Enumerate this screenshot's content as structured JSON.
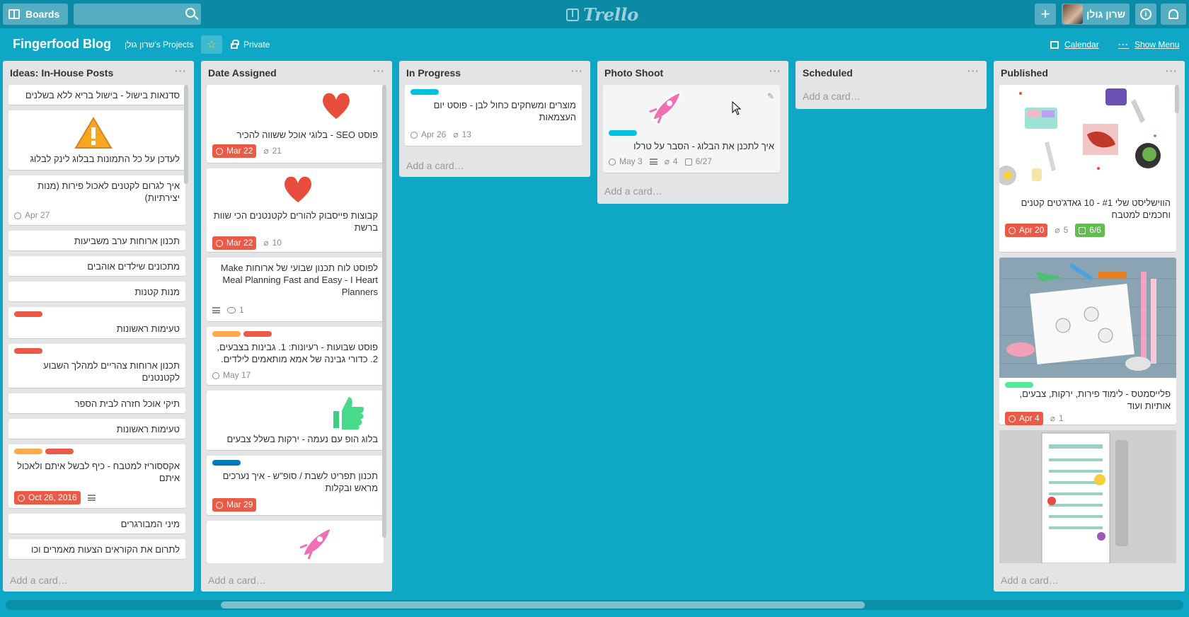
{
  "header": {
    "boards_label": "Boards",
    "logo_text": "Trello",
    "user_name": "שרון גולן"
  },
  "board": {
    "title": "Fingerfood Blog",
    "team": "שרון גולן's Projects",
    "visibility": "Private",
    "calendar_label": "Calendar",
    "show_menu_label": "Show Menu"
  },
  "add_card": "Add a card…",
  "lists": [
    {
      "title": "Ideas: In-House Posts",
      "cards": [
        {
          "text": "סדנאות בישול - בישול בריא ללא בשלנים"
        },
        {
          "text": "לעדכן על כל התמונות בבלוג לינק לבלוג"
        },
        {
          "text": "איך לגרום לקטנים לאכול פירות (מנות יצירתיות)",
          "due": "Apr 27"
        },
        {
          "text": "תכנון ארוחות ערב משביעות"
        },
        {
          "text": "מתכונים שילדים אוהבים"
        },
        {
          "text": "מנות קטנות"
        },
        {
          "text": "טעימות ראשונות"
        },
        {
          "text": "תכנון ארוחות צהריים למהלך השבוע לקטנטנים"
        },
        {
          "text": "תיקי אוכל חזרה לבית הספר"
        },
        {
          "text": "טעימות ראשונות"
        },
        {
          "text": "אקססוריז למטבח - כיף לבשל איתם ולאכול איתם",
          "due": "Oct 26, 2016"
        },
        {
          "text": "מיני המבורגרים"
        },
        {
          "text": "לתרום את הקוראים הצעות מאמרים וכו"
        }
      ]
    },
    {
      "title": "Date Assigned",
      "cards": [
        {
          "text": "פוסט SEO - בלוגי אוכל ששווה להכיר",
          "due": "Mar 22",
          "attachments": "21"
        },
        {
          "text": "קבוצות פייסבוק להורים לקטנטנים הכי שוות ברשת",
          "due": "Mar 22",
          "attachments": "10"
        },
        {
          "text": "לפוסט לוח תכנון שבועי של ארוחות Make Meal Planning Fast and Easy - I Heart Planners",
          "comments": "1"
        },
        {
          "text": "פוסט שבועות - רעיונות: 1. גבינות בצבעים, 2. כדורי גבינה של אמא מותאמים לילדים.",
          "due": "May 17"
        },
        {
          "text": "בלוג הופ עם נעמה - ירקות בשלל צבעים"
        },
        {
          "text": "תכנון תפריט לשבת / סופ\"ש - איך נערכים מראש ובקלות",
          "due": "Mar 29"
        }
      ]
    },
    {
      "title": "In Progress",
      "cards": [
        {
          "text": "מוצרים ומשחקים כחול לבן - פוסט יום העצמאות",
          "due": "Apr 26",
          "attachments": "13"
        }
      ]
    },
    {
      "title": "Photo Shoot",
      "cards": [
        {
          "text": "איך לתכנן את הבלוג - הסבר על טרלו",
          "due": "May 3",
          "attachments": "4",
          "checklist": "6/27"
        }
      ]
    },
    {
      "title": "Scheduled",
      "cards": []
    },
    {
      "title": "Published",
      "cards": [
        {
          "text": "הווישליסט שלי #1 - 10 גאדג'טים קטנים וחכמים למטבח",
          "due": "Apr 20",
          "attachments": "5",
          "checklist": "6/6"
        },
        {
          "text": "פלייסמטס - לימוד פירות, ירקות, צבעים, אותיות ועוד",
          "due": "Apr 4",
          "attachments": "1"
        },
        {
          "text": ""
        }
      ]
    }
  ],
  "colors": {
    "board_bg": "#0ea8c6",
    "header_bg": "#0b8aa6",
    "list_bg": "#e2e4e6",
    "label_red": "#eb5a46",
    "label_orange": "#ffab4a",
    "label_cyan": "#00c2e0",
    "label_blue": "#0079bf",
    "label_green": "#51e898"
  }
}
